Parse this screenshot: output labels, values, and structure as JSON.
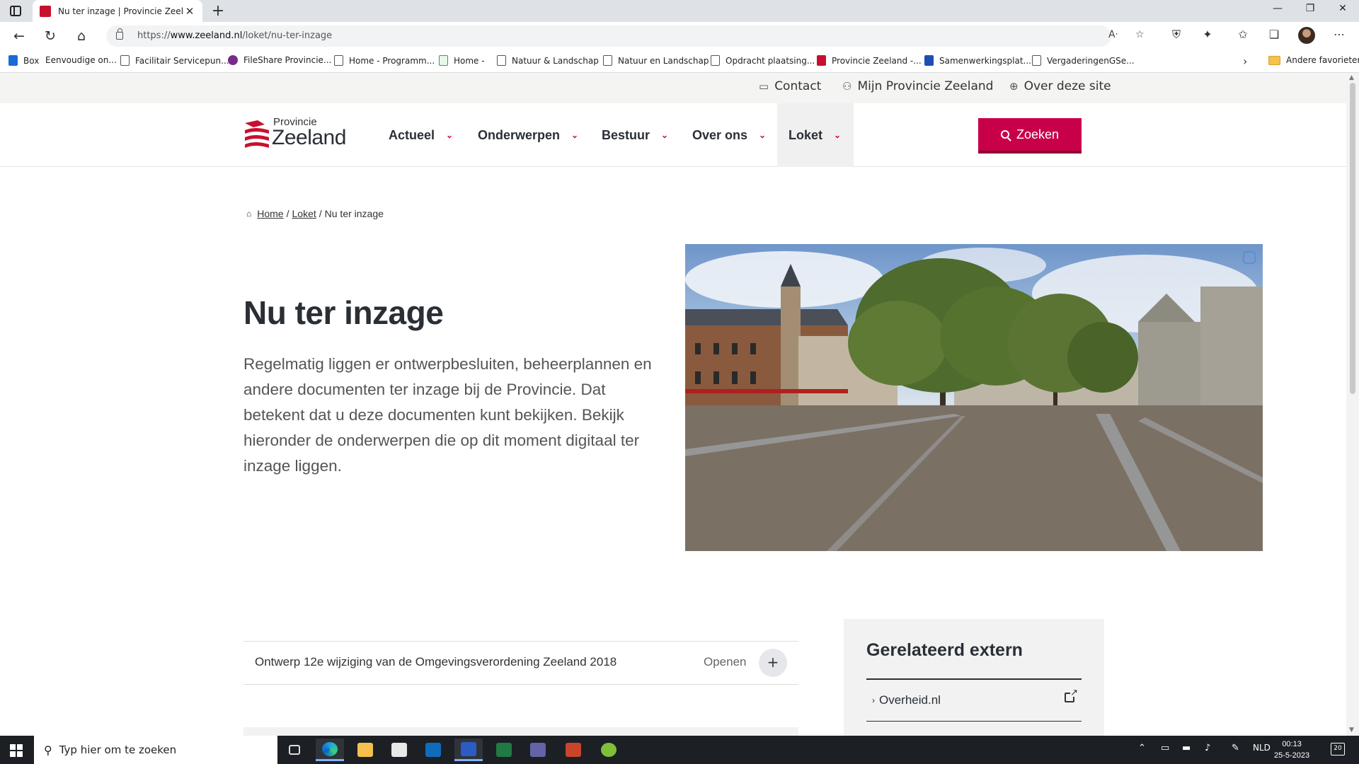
{
  "browser": {
    "tab_title": "Nu ter inzage | Provincie Zeeland",
    "url_prefix": "https://",
    "url_host": "www.zeeland.nl",
    "url_path": "/loket/nu-ter-inzage",
    "bookmarks": [
      "Box",
      "Eenvoudige on...",
      "Facilitair Servicepun...",
      "FileShare Provincie...",
      "Home - Programm...",
      "Home -",
      "Natuur & Landschap",
      "Natuur en Landschap",
      "Opdracht plaatsing...",
      "Provincie Zeeland -...",
      "Samenwerkingsplat...",
      "VergaderingenGSe..."
    ],
    "other_favorites": "Andere favorieten"
  },
  "site": {
    "util_nav": {
      "contact": "Contact",
      "mijn": "Mijn Provincie Zeeland",
      "over": "Over deze site"
    },
    "logo": {
      "small": "Provincie",
      "big": "Zeeland"
    },
    "menu": [
      "Actueel",
      "Onderwerpen",
      "Bestuur",
      "Over ons",
      "Loket"
    ],
    "search_label": "Zoeken",
    "breadcrumb": {
      "home": "Home",
      "loket": "Loket",
      "current": "Nu ter inzage",
      "sep": "/"
    },
    "title": "Nu ter inzage",
    "intro": "Regelmatig liggen er ontwerpbesluiten, beheerplannen en andere documenten ter inzage bij de Provincie. Dat betekent dat u deze documenten kunt bekijken. Bekijk hieronder de onderwerpen die op dit moment digitaal ter inzage liggen.",
    "accordion": {
      "title": "Ontwerp 12e wijziging van de Omgevingsverordening Zeeland 2018",
      "open_label": "Openen",
      "plus": "+"
    },
    "related": {
      "title": "Gerelateerd extern",
      "link": "Overheid.nl"
    }
  },
  "taskbar": {
    "search_placeholder": "Typ hier om te zoeken",
    "language": "NLD",
    "time": "00:13",
    "date": "25-5-2023",
    "notifications": "20"
  },
  "icons": {
    "back": "back-arrow-icon",
    "reload": "reload-icon",
    "home": "home-icon",
    "search": "search-icon",
    "external": "external-link-icon",
    "plus": "plus-icon"
  },
  "colors": {
    "brand": "#c8004a",
    "text_dark": "#2a2f36",
    "panel": "#f2f2f2"
  }
}
